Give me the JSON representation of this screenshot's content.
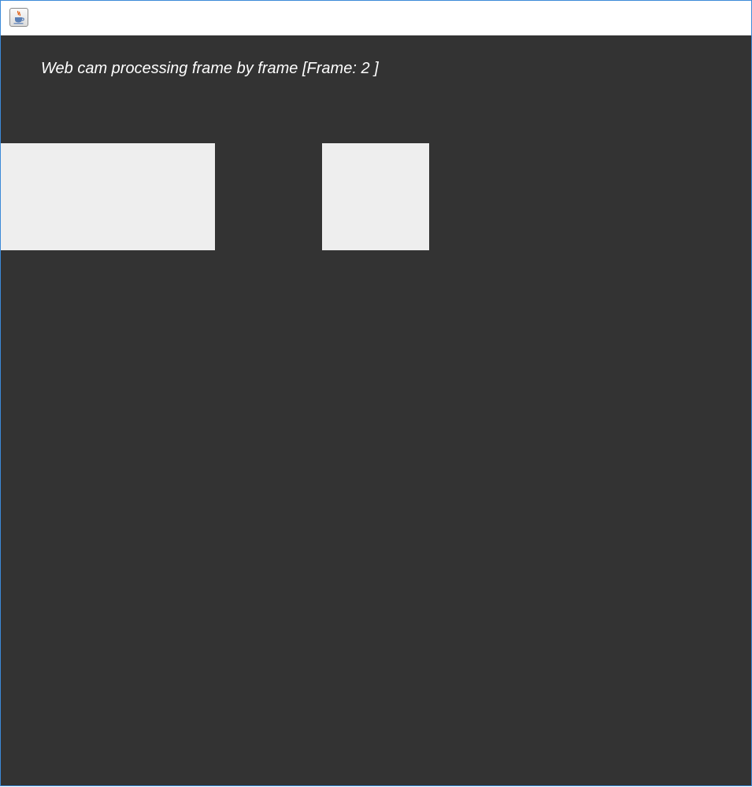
{
  "window": {
    "icon": "java-coffee-cup-icon",
    "title": ""
  },
  "canvas": {
    "background_color": "#333333",
    "panel_color": "#eeeeee",
    "caption_prefix": "Web cam processing frame by frame [Frame: ",
    "frame_number": "2",
    "caption_suffix": " ]"
  }
}
